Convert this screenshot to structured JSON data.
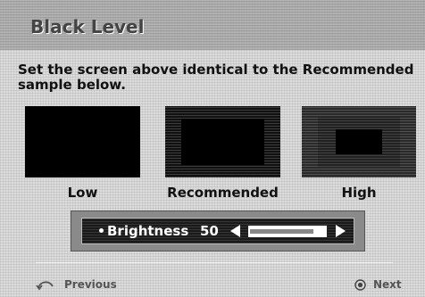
{
  "title": "Black Level",
  "instruction": "Set the screen above identical to the Recommended sample below.",
  "samples": [
    {
      "label": "Low"
    },
    {
      "label": "Recommended"
    },
    {
      "label": "High"
    }
  ],
  "setting": {
    "label": "Brightness",
    "value": "50",
    "level": 0.85
  },
  "nav": {
    "previous": "Previous",
    "next": "Next",
    "previous_icon": "return-icon",
    "next_icon": "enter-icon"
  },
  "colors": {
    "panel_bg": "#1a1a1a",
    "panel_frame": "#8a8a8a",
    "accent_text": "#ffffff"
  }
}
